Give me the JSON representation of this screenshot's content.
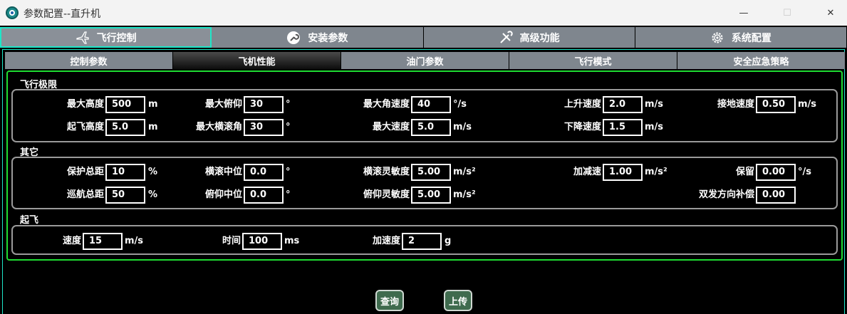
{
  "window": {
    "title": "参数配置--直升机",
    "controls": {
      "minimize": "—",
      "maximize": "☐",
      "close": "✕"
    }
  },
  "main_tabs": [
    {
      "label": "飞行控制",
      "icon": "plane-icon",
      "active": true
    },
    {
      "label": "安装参数",
      "icon": "wrench-icon",
      "active": false
    },
    {
      "label": "高级功能",
      "icon": "tools-icon",
      "active": false
    },
    {
      "label": "系统配置",
      "icon": "gear-icon",
      "active": false
    }
  ],
  "sub_tabs": [
    {
      "label": "控制参数",
      "active": false
    },
    {
      "label": "飞机性能",
      "active": true
    },
    {
      "label": "油门参数",
      "active": false
    },
    {
      "label": "飞行模式",
      "active": false
    },
    {
      "label": "安全应急策略",
      "active": false
    }
  ],
  "sections": {
    "flight_limits": {
      "title": "飞行极限",
      "fields": {
        "max_altitude": {
          "label": "最大高度",
          "value": "500",
          "unit": "m"
        },
        "max_pitch": {
          "label": "最大俯仰",
          "value": "30",
          "unit": "°"
        },
        "max_angular_speed": {
          "label": "最大角速度",
          "value": "40",
          "unit": "°/s"
        },
        "climb_speed": {
          "label": "上升速度",
          "value": "2.0",
          "unit": "m/s"
        },
        "touchdown_speed": {
          "label": "接地速度",
          "value": "0.50",
          "unit": "m/s"
        },
        "takeoff_altitude": {
          "label": "起飞高度",
          "value": "5.0",
          "unit": "m"
        },
        "max_roll": {
          "label": "最大横滚角",
          "value": "30",
          "unit": "°"
        },
        "max_speed": {
          "label": "最大速度",
          "value": "5.0",
          "unit": "m/s"
        },
        "descent_speed": {
          "label": "下降速度",
          "value": "1.5",
          "unit": "m/s"
        }
      }
    },
    "other": {
      "title": "其它",
      "fields": {
        "protect_total_distance": {
          "label": "保护总距",
          "value": "10",
          "unit": "%"
        },
        "roll_neutral": {
          "label": "横滚中位",
          "value": "0.0",
          "unit": "°"
        },
        "roll_sensitivity": {
          "label": "横滚灵敏度",
          "value": "5.00",
          "unit": "m/s²"
        },
        "acceleration": {
          "label": "加减速",
          "value": "1.00",
          "unit": "m/s²"
        },
        "reserved": {
          "label": "保留",
          "value": "0.00",
          "unit": "°/s"
        },
        "cruise_total_distance": {
          "label": "巡航总距",
          "value": "50",
          "unit": "%"
        },
        "pitch_neutral": {
          "label": "俯仰中位",
          "value": "0.0",
          "unit": "°"
        },
        "pitch_sensitivity": {
          "label": "俯仰灵敏度",
          "value": "5.00",
          "unit": "m/s²"
        },
        "twin_engine_compensation": {
          "label": "双发方向补偿",
          "value": "0.00",
          "unit": ""
        }
      }
    },
    "takeoff": {
      "title": "起飞",
      "fields": {
        "speed": {
          "label": "速度",
          "value": "15",
          "unit": "m/s"
        },
        "time": {
          "label": "时间",
          "value": "100",
          "unit": "ms"
        },
        "accel": {
          "label": "加速度",
          "value": "2",
          "unit": "g"
        }
      }
    }
  },
  "buttons": {
    "query": "查询",
    "upload": "上传"
  },
  "colors": {
    "active_tab_border": "#1ee6c8",
    "panel_border": "#1edc32",
    "button_bg": "#3f6b4e",
    "tab_bg": "#7f868e"
  }
}
